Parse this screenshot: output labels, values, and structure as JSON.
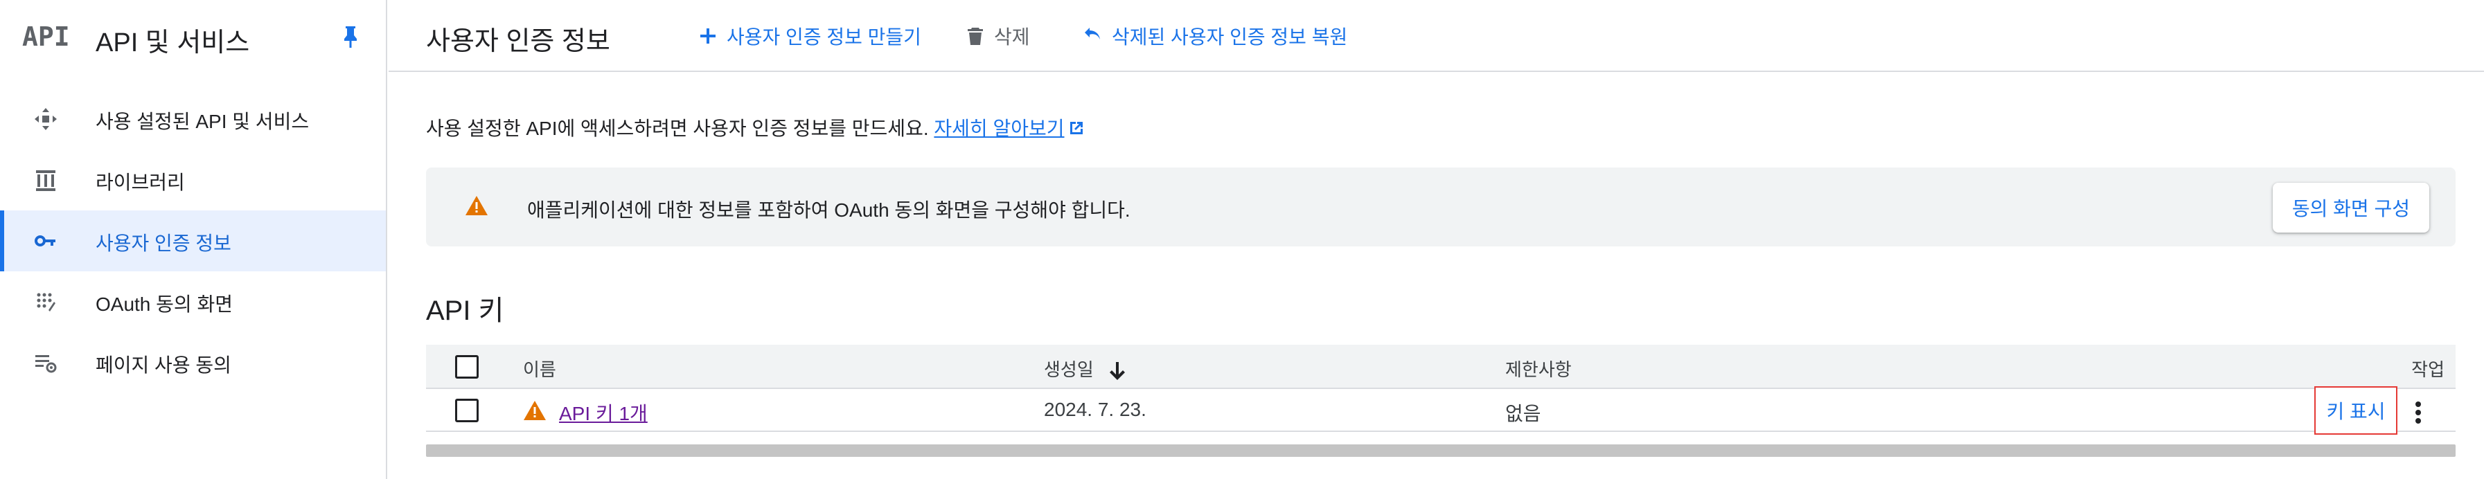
{
  "sidebar": {
    "logo_text": "API",
    "title": "API 및 서비스",
    "items": [
      {
        "label": "사용 설정된 API 및 서비스",
        "icon": "enabled-apis-icon"
      },
      {
        "label": "라이브러리",
        "icon": "library-icon"
      },
      {
        "label": "사용자 인증 정보",
        "icon": "key-icon",
        "active": true
      },
      {
        "label": "OAuth 동의 화면",
        "icon": "oauth-consent-icon"
      },
      {
        "label": "페이지 사용 동의",
        "icon": "page-settings-icon"
      }
    ]
  },
  "header": {
    "title": "사용자 인증 정보",
    "create_label": "사용자 인증 정보 만들기",
    "delete_label": "삭제",
    "restore_label": "삭제된 사용자 인증 정보 복원"
  },
  "intro": {
    "text": "사용 설정한 API에 액세스하려면 사용자 인증 정보를 만드세요.",
    "link_label": "자세히 알아보기"
  },
  "banner": {
    "message": "애플리케이션에 대한 정보를 포함하여 OAuth 동의 화면을 구성해야 합니다.",
    "button_label": "동의 화면 구성"
  },
  "api_keys": {
    "section_title": "API 키",
    "columns": {
      "name": "이름",
      "created": "생성일",
      "restrictions": "제한사항",
      "actions": "작업"
    },
    "rows": [
      {
        "name": "API 키 1개",
        "created": "2024. 7. 23.",
        "restrictions": "없음",
        "show_key_label": "키 표시"
      }
    ]
  },
  "colors": {
    "accent": "#1a73e8",
    "active_bg": "#e8f0fe",
    "warning": "#e37400",
    "highlight_border": "#e53935",
    "visited_link": "#6a1b9a"
  }
}
